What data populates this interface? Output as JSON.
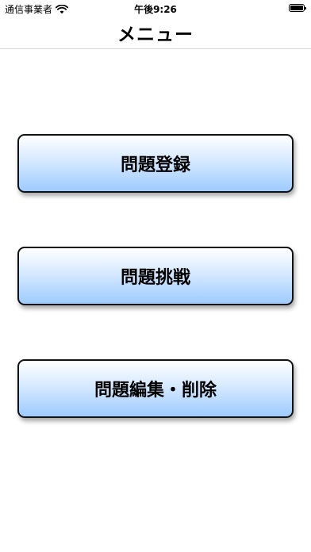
{
  "status_bar": {
    "carrier": "通信事業者",
    "time": "午後9:26"
  },
  "nav": {
    "title": "メニュー"
  },
  "menu": {
    "items": [
      {
        "label": "問題登録"
      },
      {
        "label": "問題挑戦"
      },
      {
        "label": "問題編集・削除"
      }
    ]
  },
  "icons": {
    "wifi": "wifi-icon",
    "battery": "battery-icon"
  },
  "colors": {
    "button_gradient_top": "#ffffff",
    "button_gradient_bottom": "#9ecbff",
    "button_border": "#111111"
  }
}
